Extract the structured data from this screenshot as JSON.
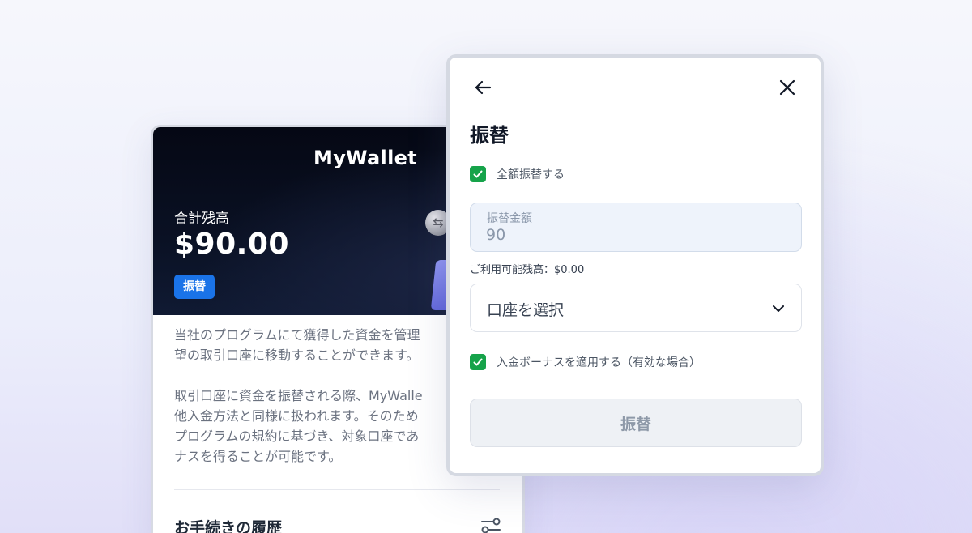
{
  "wallet": {
    "title": "MyWallet",
    "balance_label": "合計残高",
    "balance_value": "$90.00",
    "transfer_button": "振替",
    "description_1": "当社のプログラムにて獲得した資金を管理\n望の取引口座に移動することができます。",
    "description_2": "取引口座に資金を振替される際、MyWalle\n他入金方法と同様に扱われます。そのため\nプログラムの規約に基づき、対象口座であ\nナスを得ることが可能です。",
    "history_title": "お手続きの履歴",
    "icons": {
      "coin": "coin-exchange-icon",
      "filter": "filter-sliders-icon"
    }
  },
  "modal": {
    "title": "振替",
    "full_transfer_label": "全額振替する",
    "full_transfer_checked": true,
    "amount_label": "振替金額",
    "amount_value": "90",
    "available_balance": "ご利用可能残高：$0.00",
    "account_select_label": "口座を選択",
    "bonus_label": "入金ボーナスを適用する（有効な場合）",
    "bonus_checked": true,
    "submit_label": "振替",
    "icons": {
      "back": "arrow-left-icon",
      "close": "close-icon",
      "dropdown": "chevron-down-icon",
      "check": "check-icon"
    }
  },
  "colors": {
    "accent_blue": "#1a73e8",
    "check_green": "#16a34a",
    "hero_dark": "#050814",
    "field_bg": "#eef3fb",
    "disabled_button": "#eef1f5"
  }
}
